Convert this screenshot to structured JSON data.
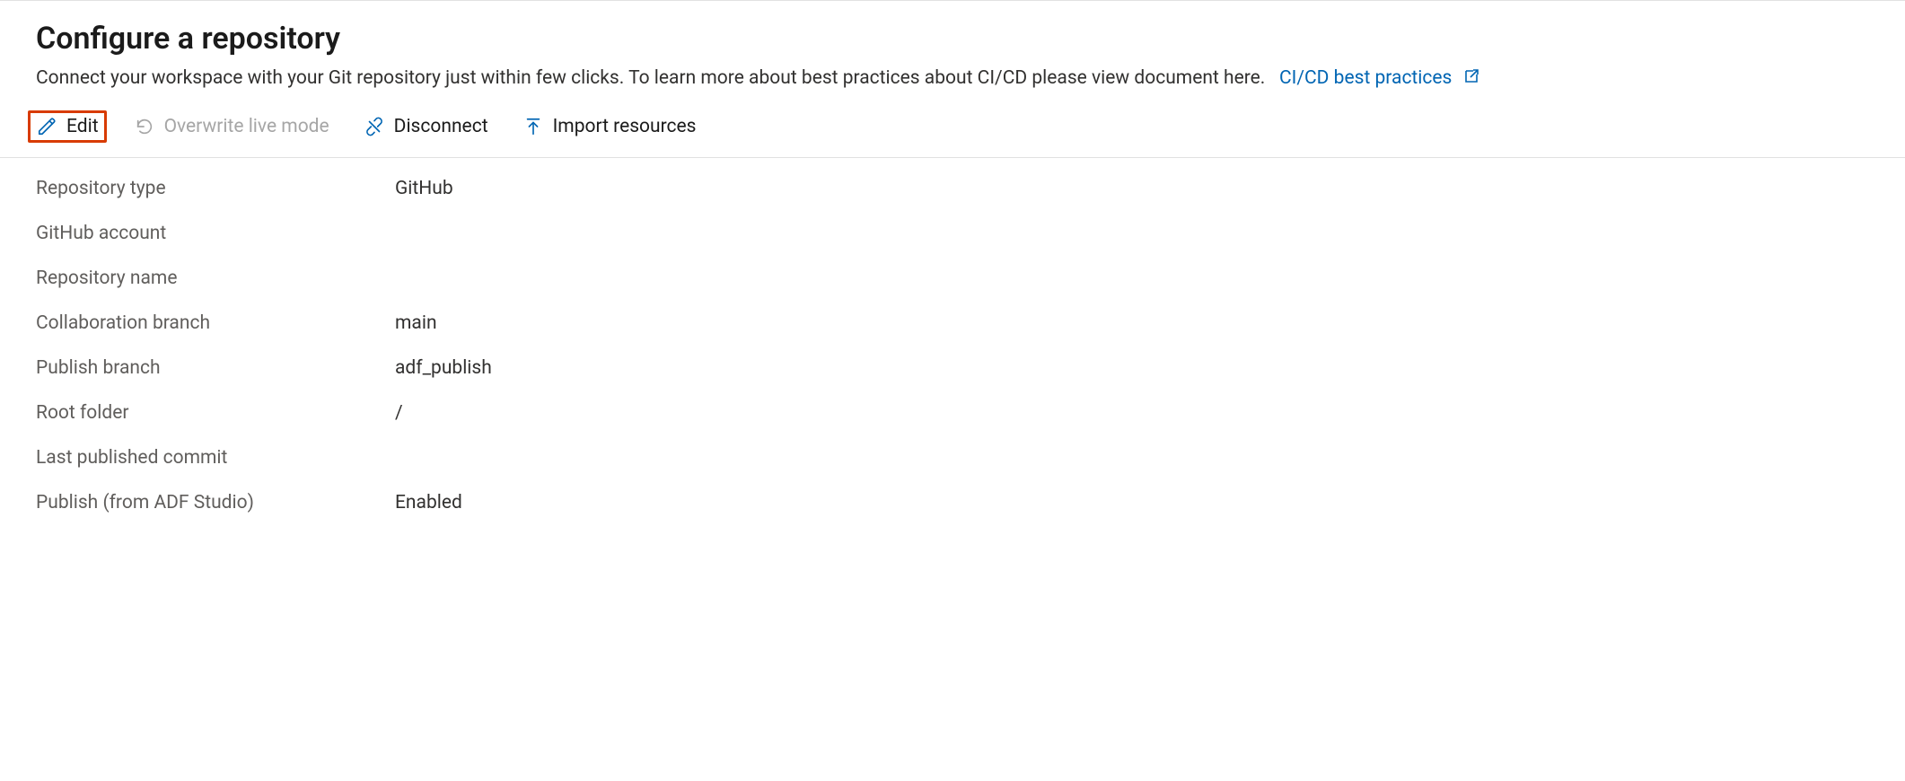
{
  "header": {
    "title": "Configure a repository",
    "description_prefix": "Connect your workspace with your Git repository just within few clicks. To learn more about best practices about CI/CD please view document here.",
    "cicd_link_label": "CI/CD best practices"
  },
  "toolbar": {
    "edit_label": "Edit",
    "overwrite_label": "Overwrite live mode",
    "disconnect_label": "Disconnect",
    "import_label": "Import resources"
  },
  "details": {
    "rows": [
      {
        "label": "Repository type",
        "value": "GitHub"
      },
      {
        "label": "GitHub account",
        "value": ""
      },
      {
        "label": "Repository name",
        "value": ""
      },
      {
        "label": "Collaboration branch",
        "value": "main"
      },
      {
        "label": "Publish branch",
        "value": "adf_publish"
      },
      {
        "label": "Root folder",
        "value": "/"
      },
      {
        "label": "Last published commit",
        "value": ""
      },
      {
        "label": "Publish (from ADF Studio)",
        "value": "Enabled"
      }
    ]
  },
  "colors": {
    "link": "#0065b3",
    "highlight_border": "#d83b01",
    "muted": "#605e5c",
    "disabled": "#a6a6a6"
  }
}
